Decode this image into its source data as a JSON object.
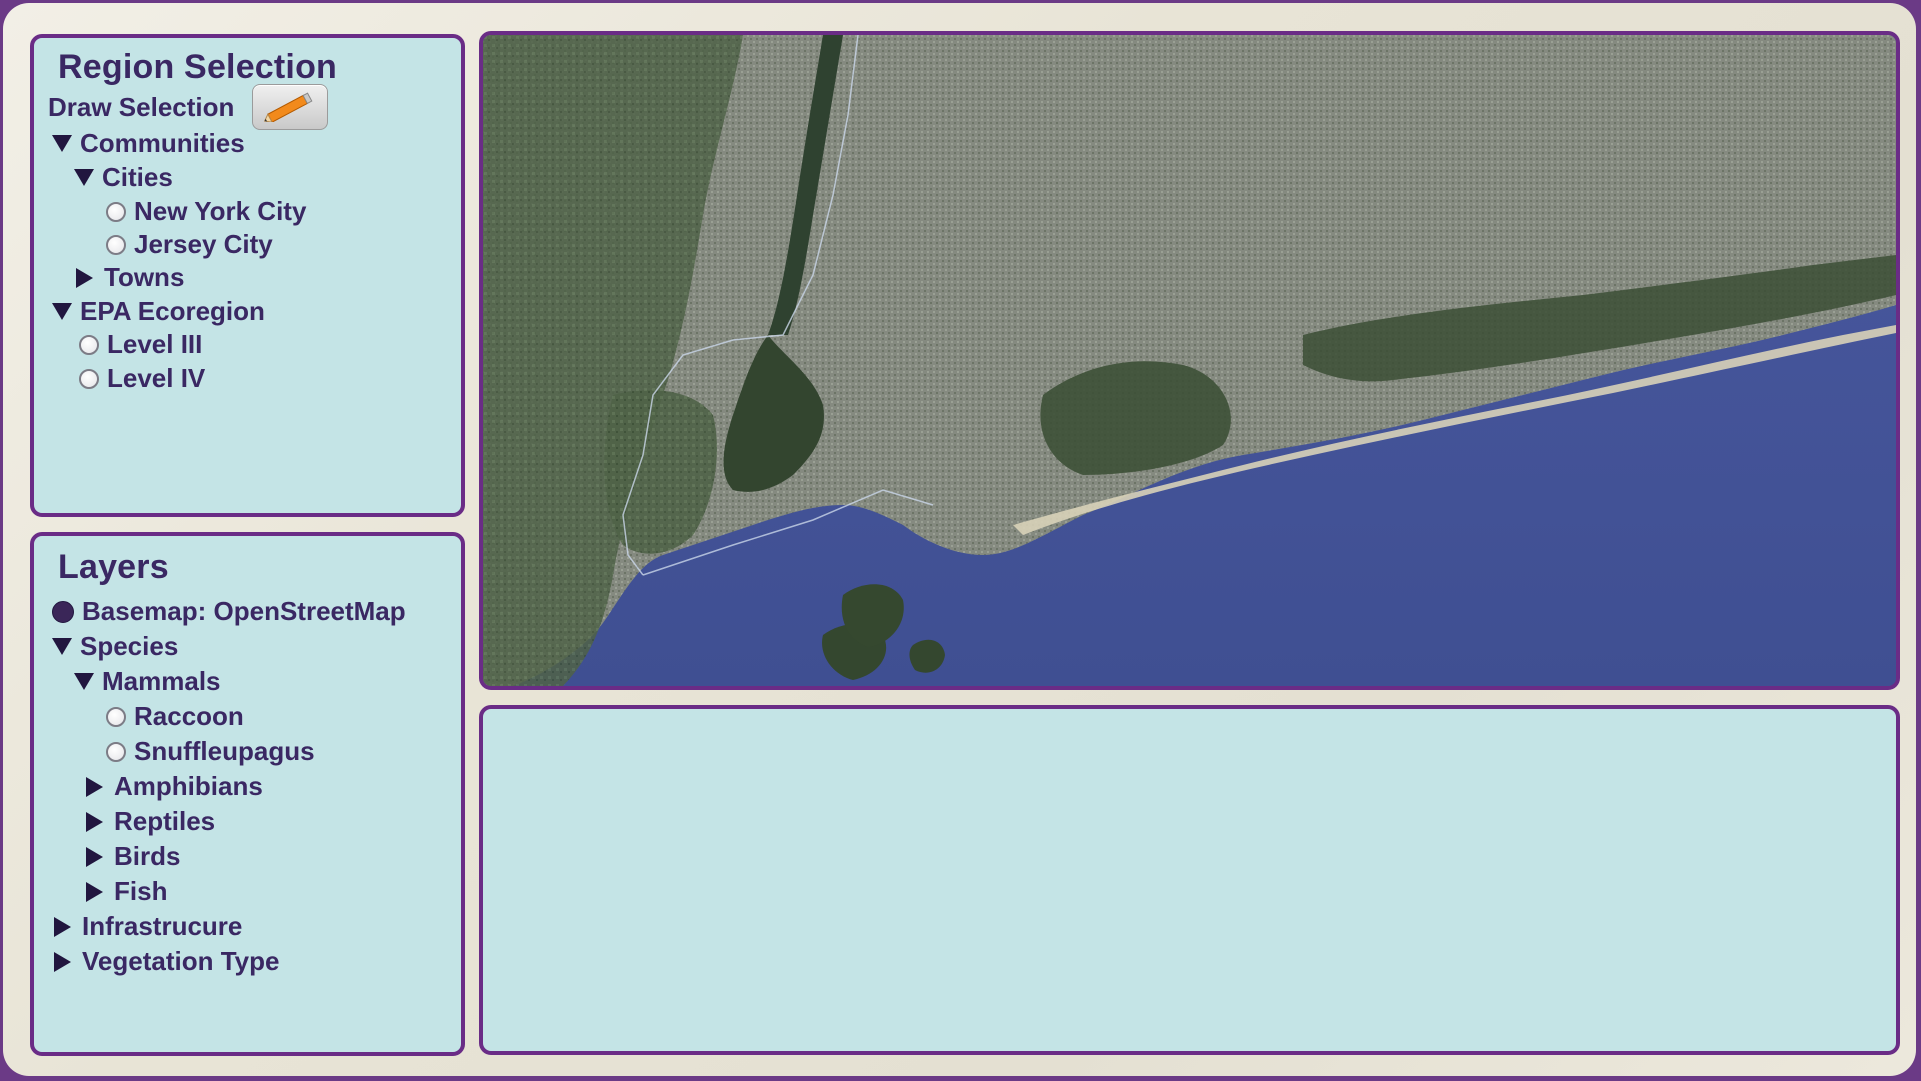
{
  "colors": {
    "frame_border": "#6b3a86",
    "panel_bg": "#c4e4e6",
    "panel_border": "#6a2c86",
    "text": "#3a2863",
    "sea": "#42508f",
    "land": "#6e7a66"
  },
  "region_selection": {
    "title": "Region Selection",
    "draw_selection_label": "Draw Selection",
    "draw_icon": "pencil-icon",
    "tree": {
      "communities": "Communities",
      "cities": "Cities",
      "new_york_city": "New York City",
      "jersey_city": "Jersey City",
      "towns": "Towns",
      "epa_ecoregion": "EPA Ecoregion",
      "level_iii": "Level III",
      "level_iv": "Level IV"
    }
  },
  "layers": {
    "title": "Layers",
    "basemap": "Basemap: OpenStreetMap",
    "species": "Species",
    "mammals": "Mammals",
    "raccoon": "Raccoon",
    "snuffleupagus": "Snuffleupagus",
    "amphibians": "Amphibians",
    "reptiles": "Reptiles",
    "birds": "Birds",
    "fish": "Fish",
    "infrastructure": "Infrastrucure",
    "vegetation_type": "Vegetation Type"
  },
  "map": {
    "basemap": "satellite imagery - New York City and Long Island south shore"
  },
  "info_panel": {
    "content": ""
  }
}
